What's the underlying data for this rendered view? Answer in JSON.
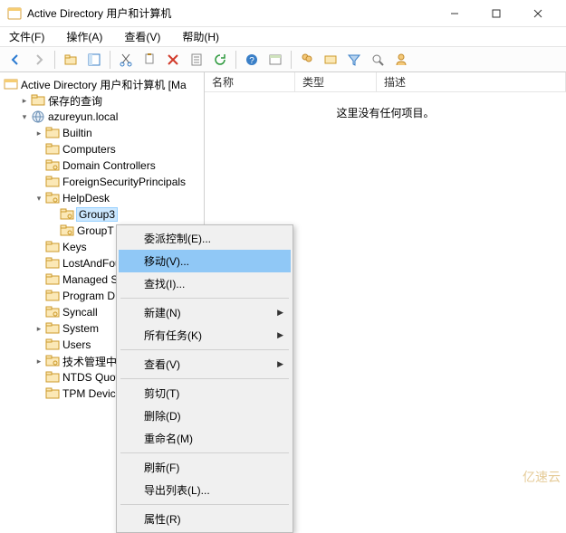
{
  "window": {
    "title": "Active Directory 用户和计算机"
  },
  "menubar": [
    "文件(F)",
    "操作(A)",
    "查看(V)",
    "帮助(H)"
  ],
  "tree": {
    "root": "Active Directory 用户和计算机 [Ma",
    "nodes": [
      {
        "label": "保存的查询",
        "indent": 1,
        "twisty": ">",
        "icon": "folder"
      },
      {
        "label": "azureyun.local",
        "indent": 1,
        "twisty": "v",
        "icon": "domain"
      },
      {
        "label": "Builtin",
        "indent": 2,
        "twisty": ">",
        "icon": "folder"
      },
      {
        "label": "Computers",
        "indent": 2,
        "twisty": "",
        "icon": "folder"
      },
      {
        "label": "Domain Controllers",
        "indent": 2,
        "twisty": "",
        "icon": "ou"
      },
      {
        "label": "ForeignSecurityPrincipals",
        "indent": 2,
        "twisty": "",
        "icon": "folder"
      },
      {
        "label": "HelpDesk",
        "indent": 2,
        "twisty": "v",
        "icon": "ou"
      },
      {
        "label": "Group3",
        "indent": 3,
        "twisty": "",
        "icon": "ou",
        "selected": true
      },
      {
        "label": "GroupT",
        "indent": 3,
        "twisty": "",
        "icon": "ou"
      },
      {
        "label": "Keys",
        "indent": 2,
        "twisty": "",
        "icon": "folder"
      },
      {
        "label": "LostAndFou",
        "indent": 2,
        "twisty": "",
        "icon": "folder"
      },
      {
        "label": "Managed S",
        "indent": 2,
        "twisty": "",
        "icon": "folder"
      },
      {
        "label": "Program D",
        "indent": 2,
        "twisty": "",
        "icon": "folder"
      },
      {
        "label": "Syncall",
        "indent": 2,
        "twisty": "",
        "icon": "ou"
      },
      {
        "label": "System",
        "indent": 2,
        "twisty": ">",
        "icon": "folder"
      },
      {
        "label": "Users",
        "indent": 2,
        "twisty": "",
        "icon": "folder"
      },
      {
        "label": "技术管理中",
        "indent": 2,
        "twisty": ">",
        "icon": "ou"
      },
      {
        "label": "NTDS Quot",
        "indent": 2,
        "twisty": "",
        "icon": "folder"
      },
      {
        "label": "TPM Device",
        "indent": 2,
        "twisty": "",
        "icon": "folder"
      }
    ]
  },
  "list": {
    "columns": [
      "名称",
      "类型",
      "描述"
    ],
    "empty": "这里没有任何项目。"
  },
  "context_menu": [
    {
      "label": "委派控制(E)...",
      "type": "item"
    },
    {
      "label": "移动(V)...",
      "type": "item",
      "highlight": true
    },
    {
      "label": "查找(I)...",
      "type": "item"
    },
    {
      "type": "sep"
    },
    {
      "label": "新建(N)",
      "type": "item",
      "submenu": true
    },
    {
      "label": "所有任务(K)",
      "type": "item",
      "submenu": true
    },
    {
      "type": "sep"
    },
    {
      "label": "查看(V)",
      "type": "item",
      "submenu": true
    },
    {
      "type": "sep"
    },
    {
      "label": "剪切(T)",
      "type": "item"
    },
    {
      "label": "删除(D)",
      "type": "item"
    },
    {
      "label": "重命名(M)",
      "type": "item"
    },
    {
      "type": "sep"
    },
    {
      "label": "刷新(F)",
      "type": "item"
    },
    {
      "label": "导出列表(L)...",
      "type": "item"
    },
    {
      "type": "sep"
    },
    {
      "label": "属性(R)",
      "type": "item"
    }
  ],
  "watermark": "亿速云"
}
